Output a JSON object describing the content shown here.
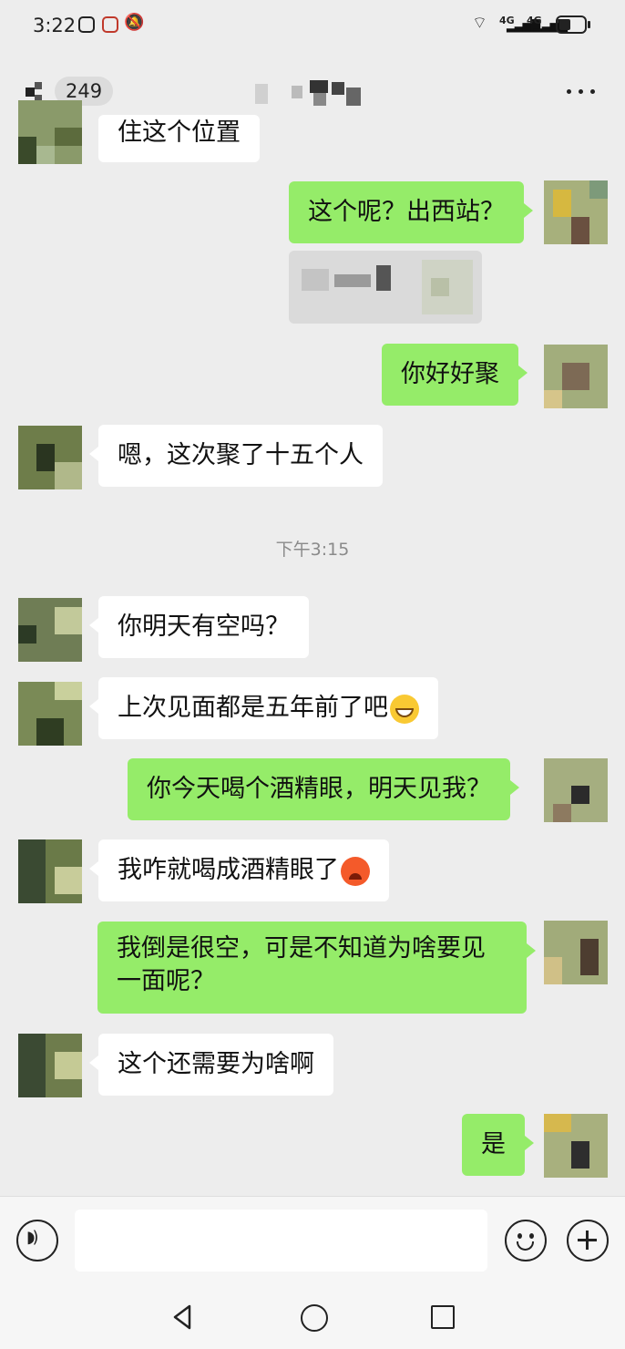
{
  "status_bar": {
    "time": "3:22",
    "network_label_1": "4G",
    "network_label_2": "4G"
  },
  "header": {
    "unread_count": "249"
  },
  "timestamp": "下午3:15",
  "messages": [
    {
      "text": "住这个位置"
    },
    {
      "text": "这个呢？出西站？"
    },
    {
      "text": "你好好聚"
    },
    {
      "text": "嗯，这次聚了十五个人"
    },
    {
      "text": "你明天有空吗？"
    },
    {
      "text": "上次见面都是五年前了吧"
    },
    {
      "text": "你今天喝个酒精眼，明天见我？"
    },
    {
      "text": "我咋就喝成酒精眼了"
    },
    {
      "text": "我倒是很空，可是不知道为啥要见一面呢？"
    },
    {
      "text": "这个还需要为啥啊"
    },
    {
      "text": "是"
    }
  ],
  "icons": {
    "emoji_1": "grinning-face",
    "emoji_2": "hot-face"
  },
  "colors": {
    "outgoing_bubble": "#95ec69",
    "incoming_bubble": "#ffffff",
    "background": "#ededed"
  },
  "input": {
    "value": ""
  }
}
